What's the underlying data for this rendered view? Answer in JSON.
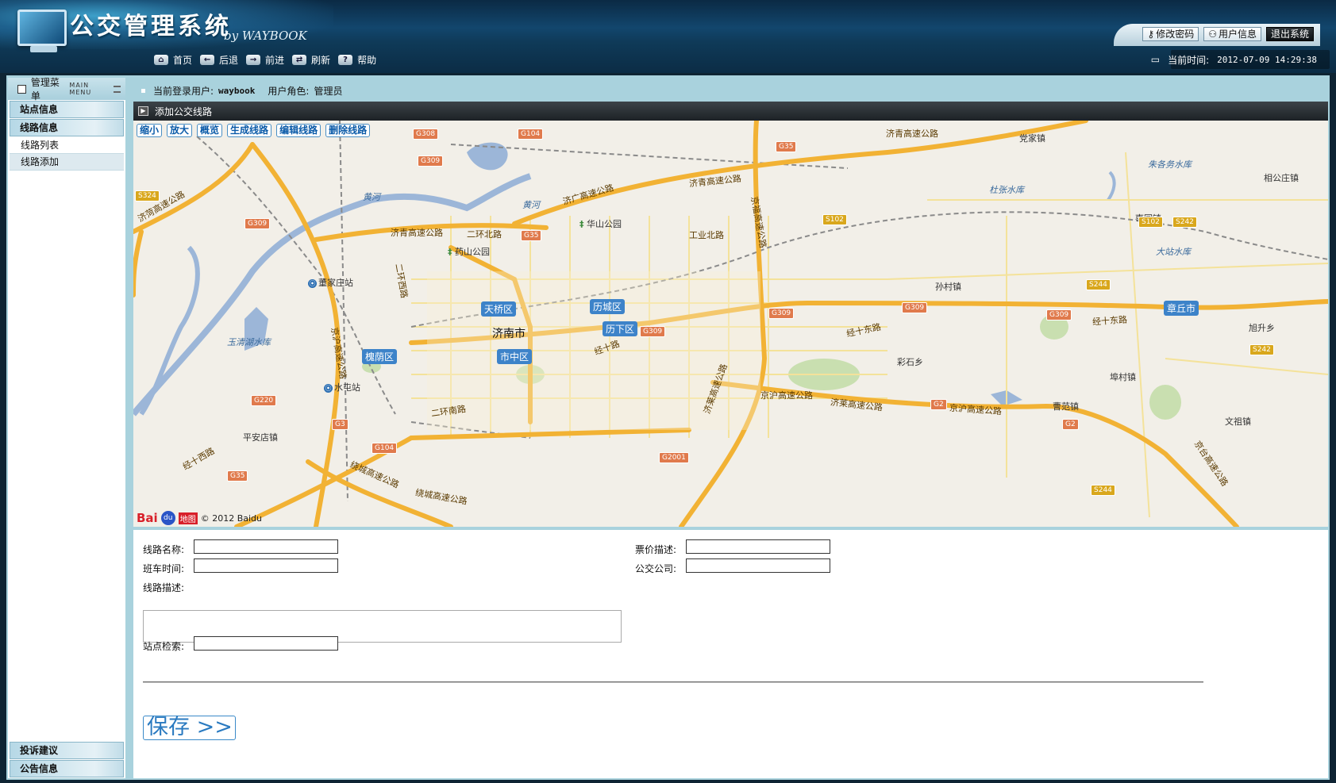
{
  "app": {
    "title": "公交管理系统",
    "subtitle": "by WAYBOOK"
  },
  "top_actions": {
    "change_password": "修改密码",
    "user_info": "用户信息",
    "logout": "退出系统"
  },
  "nav": [
    {
      "label": "首页",
      "icon": "home-icon"
    },
    {
      "label": "后退",
      "icon": "back-icon"
    },
    {
      "label": "前进",
      "icon": "forward-icon"
    },
    {
      "label": "刷新",
      "icon": "refresh-icon"
    },
    {
      "label": "帮助",
      "icon": "help-icon"
    }
  ],
  "clock": {
    "label": "当前时间:",
    "value": "2012-07-09 14:29:38"
  },
  "sidebar": {
    "title": "管理菜单",
    "title_en": "MAIN MENU",
    "cat_stations": "站点信息",
    "cat_routes": "线路信息",
    "sub_route_list": "线路列表",
    "sub_route_add": "线路添加",
    "cat_complaints": "投诉建议",
    "cat_notices": "公告信息"
  },
  "session": {
    "user_label": "当前登录用户:",
    "user": "waybook",
    "role_label": "用户角色:",
    "role": "管理员"
  },
  "section_title": "添加公交线路",
  "map": {
    "buttons": [
      "缩小",
      "放大",
      "概览",
      "生成线路",
      "编辑线路",
      "删除线路"
    ],
    "city": "济南市",
    "districts": [
      "天桥区",
      "历城区",
      "历下区",
      "市中区",
      "槐荫区",
      "章丘市"
    ],
    "towns": [
      "党家镇",
      "相公庄镇",
      "枣园镇",
      "孙村镇",
      "旭升乡",
      "彩石乡",
      "埠村镇",
      "曹范镇",
      "文祖镇",
      "平安店镇"
    ],
    "water": [
      "黄河",
      "黄河",
      "玉清湖水库",
      "杜张水库",
      "朱各务水库",
      "大站水库"
    ],
    "parks": [
      "华山公园",
      "药山公园"
    ],
    "stations": [
      "董家庄站",
      "水屯站"
    ],
    "roads": [
      "济青高速公路",
      "济青高速公路",
      "济广高速公路",
      "济青高速公路",
      "济菏高速公路",
      "京福高速公路",
      "二环北路",
      "工业北路",
      "二环西路",
      "经十路",
      "经十东路",
      "经十东路",
      "京沪高速公路",
      "济莱高速公路",
      "京沪高速公路",
      "二环南路",
      "绕城高速公路",
      "京沪高速公路",
      "经十西路",
      "绕城高速公路",
      "济莱高速公路",
      "京台高速公路"
    ],
    "shields": [
      "G308",
      "G104",
      "G309",
      "S324",
      "G309",
      "G35",
      "G35",
      "S102",
      "S102",
      "S242",
      "S244",
      "G309",
      "G309",
      "G309",
      "G309",
      "G220",
      "G3",
      "G104",
      "G35",
      "G2001",
      "G2",
      "G2",
      "S242",
      "S244"
    ],
    "copyright": "© 2012 Baidu",
    "logo_a": "Bai",
    "logo_b": "du",
    "logo_c": "地图"
  },
  "form": {
    "route_name": "线路名称:",
    "fare_desc": "票价描述:",
    "bus_time": "班车时间:",
    "company": "公交公司:",
    "route_desc": "线路描述:",
    "station_search": "站点检索:",
    "save": "保存 >>"
  }
}
